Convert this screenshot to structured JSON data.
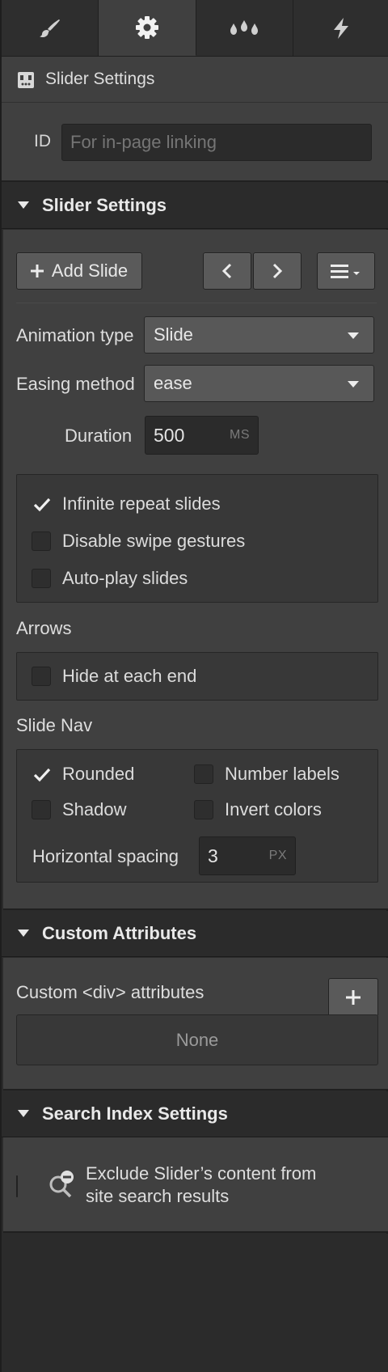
{
  "tabs": [
    {
      "name": "style",
      "icon": "brush-icon",
      "active": false
    },
    {
      "name": "settings",
      "icon": "gear-icon",
      "active": true
    },
    {
      "name": "interactions",
      "icon": "drops-icon",
      "active": false
    },
    {
      "name": "lightning",
      "icon": "lightning-icon",
      "active": false
    }
  ],
  "header": {
    "title": "Slider Settings",
    "icon": "slider-icon"
  },
  "id_field": {
    "label": "ID",
    "placeholder": "For in-page linking"
  },
  "slider_settings": {
    "title": "Slider Settings",
    "add_slide_label": "Add Slide",
    "animation_type": {
      "label": "Animation type",
      "value": "Slide"
    },
    "easing_method": {
      "label": "Easing method",
      "value": "ease"
    },
    "duration": {
      "label": "Duration",
      "value": "500",
      "unit": "MS"
    },
    "options": [
      {
        "label": "Infinite repeat slides",
        "checked": true
      },
      {
        "label": "Disable swipe gestures",
        "checked": false
      },
      {
        "label": "Auto-play slides",
        "checked": false
      }
    ],
    "arrows": {
      "label": "Arrows",
      "hide_at_each_end": {
        "label": "Hide at each end",
        "checked": false
      }
    },
    "slide_nav": {
      "label": "Slide Nav",
      "rounded": {
        "label": "Rounded",
        "checked": true
      },
      "number_labels": {
        "label": "Number labels",
        "checked": false
      },
      "shadow": {
        "label": "Shadow",
        "checked": false
      },
      "invert_colors": {
        "label": "Invert colors",
        "checked": false
      },
      "horizontal_spacing": {
        "label": "Horizontal spacing",
        "value": "3",
        "unit": "PX"
      }
    }
  },
  "custom_attributes": {
    "title": "Custom Attributes",
    "div_label": "Custom <div> attributes",
    "empty_text": "None"
  },
  "search_index": {
    "title": "Search Index Settings",
    "exclude_label_line1": "Exclude Slider’s content from",
    "exclude_label_line2": "site search results",
    "checked": false
  }
}
